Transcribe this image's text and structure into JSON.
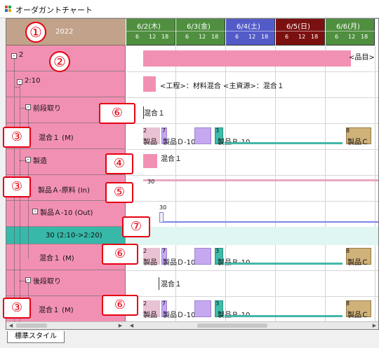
{
  "window": {
    "title": "オーダガントチャート",
    "status_tab": "標準スタイル"
  },
  "timeline": {
    "year": "2022",
    "hours": [
      "6",
      "12",
      "18"
    ],
    "days": [
      {
        "label": "6/2(木)",
        "color": "#4f8f3f"
      },
      {
        "label": "6/3(金)",
        "color": "#4f8f3f"
      },
      {
        "label": "6/4(土)",
        "color": "#535bc8"
      },
      {
        "label": "6/5(日)",
        "color": "#7b1010"
      },
      {
        "label": "6/6(月)",
        "color": "#4f8f3f"
      }
    ]
  },
  "tree": {
    "rows": [
      {
        "label": "2",
        "expander": "-"
      },
      {
        "label": "2:10",
        "expander": "-"
      },
      {
        "label": "前段取り",
        "expander": "-"
      },
      {
        "label": "混合１ (M)"
      },
      {
        "label": "製造",
        "expander": "-"
      },
      {
        "label": "製品Ａ-原料 (In)"
      },
      {
        "label": "製品Ａ-10 (Out)",
        "expander": "-"
      },
      {
        "label": "30 (2:10->2:20)"
      },
      {
        "label": "混合１ (M)"
      },
      {
        "label": "後段取り",
        "expander": "-"
      },
      {
        "label": "混合１ (M)"
      }
    ]
  },
  "chart": {
    "item_label": "<品目>",
    "process_label": "<工程>：材料混合 <主資源>：混合１",
    "mixing_label": "混合１",
    "qty_30": "30",
    "product_d": "製品Ｄ-10",
    "product_b": "製品Ｂ-10",
    "product_c": "製品Ｃ",
    "product_short": "製品",
    "num_2": "2",
    "num_7": "7",
    "num_3": "3",
    "num_8": "8"
  },
  "annotations": {
    "markers": [
      "①",
      "②",
      "③",
      "④",
      "⑤",
      "⑥",
      "⑦"
    ]
  }
}
